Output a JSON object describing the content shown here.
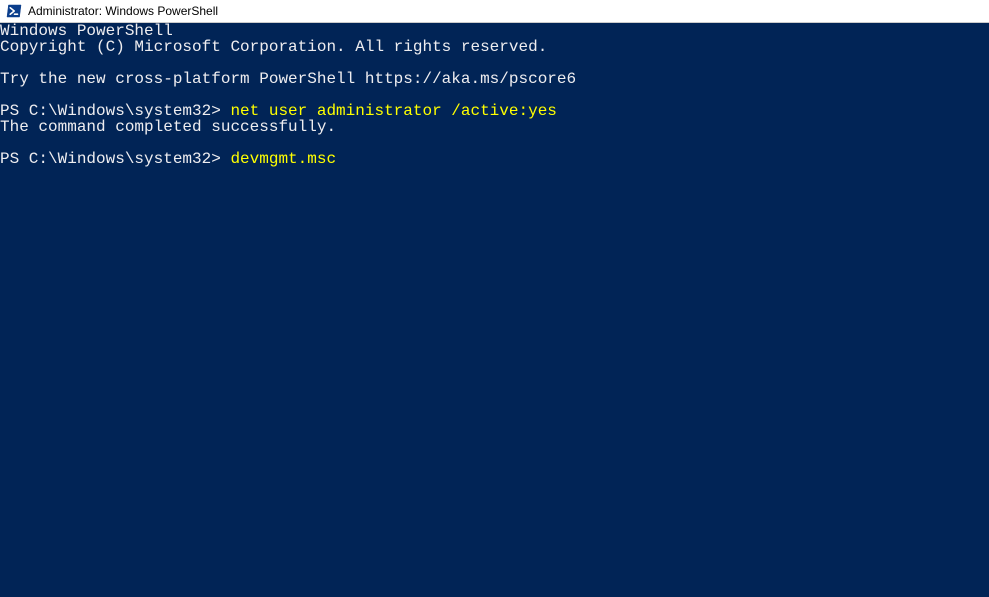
{
  "window": {
    "title": "Administrator: Windows PowerShell"
  },
  "terminal": {
    "lines": [
      {
        "type": "output",
        "text": "Windows PowerShell"
      },
      {
        "type": "output",
        "text": "Copyright (C) Microsoft Corporation. All rights reserved."
      },
      {
        "type": "blank",
        "text": ""
      },
      {
        "type": "output",
        "text": "Try the new cross-platform PowerShell https://aka.ms/pscore6"
      },
      {
        "type": "blank",
        "text": ""
      },
      {
        "type": "prompt",
        "prompt": "PS C:\\Windows\\system32> ",
        "command": "net user administrator /active:yes"
      },
      {
        "type": "output",
        "text": "The command completed successfully."
      },
      {
        "type": "blank",
        "text": ""
      },
      {
        "type": "prompt",
        "prompt": "PS C:\\Windows\\system32> ",
        "command": "devmgmt.msc"
      }
    ]
  }
}
